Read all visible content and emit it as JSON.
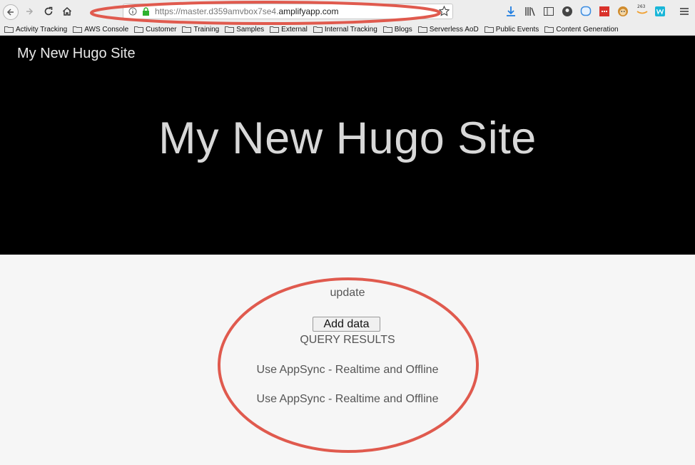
{
  "browser": {
    "url_prefix": "https://master.d359amvbox7se4.",
    "url_domain": "amplifyapp.com",
    "bookmarks": [
      "Activity Tracking",
      "AWS Console",
      "Customer",
      "Training",
      "Samples",
      "External",
      "Internal Tracking",
      "Blogs",
      "Serverless AoD",
      "Public Events",
      "Content Generation"
    ],
    "badge_text": "263",
    "icons": [
      "back-icon",
      "forward-icon",
      "reload-icon",
      "home-icon",
      "info-icon",
      "lock-icon",
      "bookmark-star-icon",
      "download-icon",
      "library-icon",
      "sidebar-icon",
      "account-icon",
      "chat-icon",
      "extension-icon",
      "monkey-icon",
      "amazon-icon",
      "w-icon",
      "menu-icon"
    ]
  },
  "site": {
    "name": "My New Hugo Site",
    "hero_title": "My New Hugo Site"
  },
  "main": {
    "update_label": "update",
    "add_button": "Add data",
    "query_heading": "QUERY RESULTS",
    "results": [
      "Use AppSync - Realtime and Offline",
      "Use AppSync - Realtime and Offline"
    ]
  },
  "colors": {
    "annotation": "#e05a4e",
    "hero_bg": "#000000",
    "page_bg": "#f6f6f6"
  }
}
